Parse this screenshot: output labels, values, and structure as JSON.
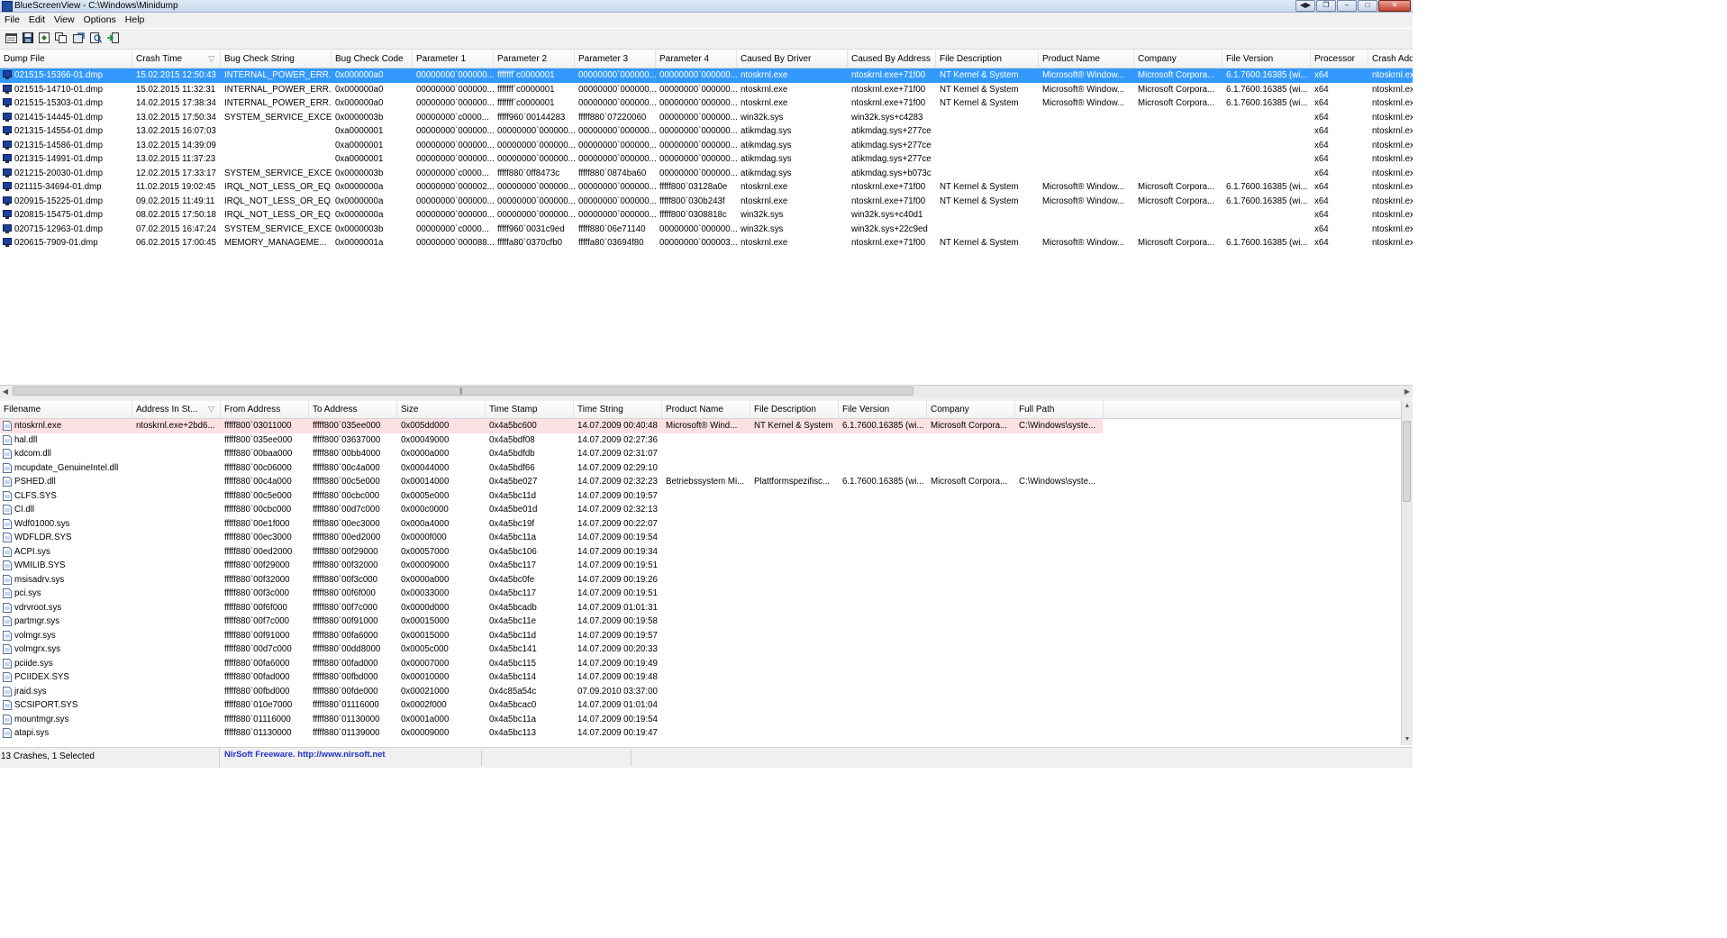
{
  "window": {
    "title": "BlueScreenView  -  C:\\Windows\\Minidump"
  },
  "menu": [
    "File",
    "Edit",
    "View",
    "Options",
    "Help"
  ],
  "toolbar_icons": [
    "properties-icon",
    "save-icon",
    "html-report-icon",
    "copy-icon",
    "refresh-icon",
    "find-icon",
    "exit-icon"
  ],
  "dumps": {
    "columns": [
      "Dump File",
      "Crash Time",
      "Bug Check String",
      "Bug Check Code",
      "Parameter 1",
      "Parameter 2",
      "Parameter 3",
      "Parameter 4",
      "Caused By Driver",
      "Caused By Address",
      "File Description",
      "Product Name",
      "Company",
      "File Version",
      "Processor",
      "Crash Address"
    ],
    "sorted_column": "Crash Time",
    "rows": [
      [
        "021515-15366-01.dmp",
        "15.02.2015 12:50:43",
        "INTERNAL_POWER_ERR...",
        "0x000000a0",
        "00000000`000000...",
        "fffffff`c0000001",
        "00000000`000000...",
        "00000000`000000...",
        "ntoskrnl.exe",
        "ntoskrnl.exe+71f00",
        "NT Kernel & System",
        "Microsoft® Window...",
        "Microsoft Corpora...",
        "6.1.7600.16385 (wi...",
        "x64",
        "ntoskrnl.exe"
      ],
      [
        "021515-14710-01.dmp",
        "15.02.2015 11:32:31",
        "INTERNAL_POWER_ERR...",
        "0x000000a0",
        "00000000`000000...",
        "fffffff`c0000001",
        "00000000`000000...",
        "00000000`000000...",
        "ntoskrnl.exe",
        "ntoskrnl.exe+71f00",
        "NT Kernel & System",
        "Microsoft® Window...",
        "Microsoft Corpora...",
        "6.1.7600.16385 (wi...",
        "x64",
        "ntoskrnl.exe"
      ],
      [
        "021515-15303-01.dmp",
        "14.02.2015 17:38:34",
        "INTERNAL_POWER_ERR...",
        "0x000000a0",
        "00000000`000000...",
        "fffffff`c0000001",
        "00000000`000000...",
        "00000000`000000...",
        "ntoskrnl.exe",
        "ntoskrnl.exe+71f00",
        "NT Kernel & System",
        "Microsoft® Window...",
        "Microsoft Corpora...",
        "6.1.7600.16385 (wi...",
        "x64",
        "ntoskrnl.exe"
      ],
      [
        "021415-14445-01.dmp",
        "13.02.2015 17:50:34",
        "SYSTEM_SERVICE_EXCE...",
        "0x0000003b",
        "00000000`c0000...",
        "fffff960`00144283",
        "fffff880`07220060",
        "00000000`000000...",
        "win32k.sys",
        "win32k.sys+c4283",
        "",
        "",
        "",
        "",
        "x64",
        "ntoskrnl.exe"
      ],
      [
        "021315-14554-01.dmp",
        "13.02.2015 16:07:03",
        "",
        "0xa0000001",
        "00000000`000000...",
        "00000000`000000...",
        "00000000`000000...",
        "00000000`000000...",
        "atikmdag.sys",
        "atikmdag.sys+277ce",
        "",
        "",
        "",
        "",
        "x64",
        "ntoskrnl.exe"
      ],
      [
        "021315-14586-01.dmp",
        "13.02.2015 14:39:09",
        "",
        "0xa0000001",
        "00000000`000000...",
        "00000000`000000...",
        "00000000`000000...",
        "00000000`000000...",
        "atikmdag.sys",
        "atikmdag.sys+277ce",
        "",
        "",
        "",
        "",
        "x64",
        "ntoskrnl.exe"
      ],
      [
        "021315-14991-01.dmp",
        "13.02.2015 11:37:23",
        "",
        "0xa0000001",
        "00000000`000000...",
        "00000000`000000...",
        "00000000`000000...",
        "00000000`000000...",
        "atikmdag.sys",
        "atikmdag.sys+277ce",
        "",
        "",
        "",
        "",
        "x64",
        "ntoskrnl.exe"
      ],
      [
        "021215-20030-01.dmp",
        "12.02.2015 17:33:17",
        "SYSTEM_SERVICE_EXCE...",
        "0x0000003b",
        "00000000`c0000...",
        "fffff880`0ff8473c",
        "fffff880`0874ba60",
        "00000000`000000...",
        "atikmdag.sys",
        "atikmdag.sys+b073c",
        "",
        "",
        "",
        "",
        "x64",
        "ntoskrnl.exe"
      ],
      [
        "021115-34694-01.dmp",
        "11.02.2015 19:02:45",
        "IRQL_NOT_LESS_OR_EQ...",
        "0x0000000a",
        "00000000`000002...",
        "00000000`000000...",
        "00000000`000000...",
        "fffff800`03128a0e",
        "ntoskrnl.exe",
        "ntoskrnl.exe+71f00",
        "NT Kernel & System",
        "Microsoft® Window...",
        "Microsoft Corpora...",
        "6.1.7600.16385 (wi...",
        "x64",
        "ntoskrnl.exe"
      ],
      [
        "020915-15225-01.dmp",
        "09.02.2015 11:49:11",
        "IRQL_NOT_LESS_OR_EQ...",
        "0x0000000a",
        "00000000`000000...",
        "00000000`000000...",
        "00000000`000000...",
        "fffff800`030b243f",
        "ntoskrnl.exe",
        "ntoskrnl.exe+71f00",
        "NT Kernel & System",
        "Microsoft® Window...",
        "Microsoft Corpora...",
        "6.1.7600.16385 (wi...",
        "x64",
        "ntoskrnl.exe"
      ],
      [
        "020815-15475-01.dmp",
        "08.02.2015 17:50:18",
        "IRQL_NOT_LESS_OR_EQ...",
        "0x0000000a",
        "00000000`000000...",
        "00000000`000000...",
        "00000000`000000...",
        "fffff800`0308818c",
        "win32k.sys",
        "win32k.sys+c40d1",
        "",
        "",
        "",
        "",
        "x64",
        "ntoskrnl.exe"
      ],
      [
        "020715-12963-01.dmp",
        "07.02.2015 16:47:24",
        "SYSTEM_SERVICE_EXCE...",
        "0x0000003b",
        "00000000`c0000...",
        "fffff960`0031c9ed",
        "fffff880`06e71140",
        "00000000`000000...",
        "win32k.sys",
        "win32k.sys+22c9ed",
        "",
        "",
        "",
        "",
        "x64",
        "ntoskrnl.exe"
      ],
      [
        "020615-7909-01.dmp",
        "06.02.2015 17:00:45",
        "MEMORY_MANAGEME...",
        "0x0000001a",
        "00000000`000088...",
        "fffffa80`0370cfb0",
        "fffffa80`03694f80",
        "00000000`000003...",
        "ntoskrnl.exe",
        "ntoskrnl.exe+71f00",
        "NT Kernel & System",
        "Microsoft® Window...",
        "Microsoft Corpora...",
        "6.1.7600.16385 (wi...",
        "x64",
        "ntoskrnl.exe"
      ]
    ]
  },
  "drivers": {
    "columns": [
      "Filename",
      "Address In St...",
      "From Address",
      "To Address",
      "Size",
      "Time Stamp",
      "Time String",
      "Product Name",
      "File Description",
      "File Version",
      "Company",
      "Full Path"
    ],
    "rows": [
      [
        "ntoskrnl.exe",
        "ntoskrnl.exe+2bd6...",
        "fffff800`03011000",
        "fffff800`035ee000",
        "0x005dd000",
        "0x4a5bc600",
        "14.07.2009 00:40:48",
        "Microsoft® Wind...",
        "NT Kernel & System",
        "6.1.7600.16385 (wi...",
        "Microsoft Corpora...",
        "C:\\Windows\\syste..."
      ],
      [
        "hal.dll",
        "",
        "fffff800`035ee000",
        "fffff800`03637000",
        "0x00049000",
        "0x4a5bdf08",
        "14.07.2009 02:27:36",
        "",
        "",
        "",
        "",
        ""
      ],
      [
        "kdcom.dll",
        "",
        "fffff880`00baa000",
        "fffff880`00bb4000",
        "0x0000a000",
        "0x4a5bdfdb",
        "14.07.2009 02:31:07",
        "",
        "",
        "",
        "",
        ""
      ],
      [
        "mcupdate_GenuineIntel.dll",
        "",
        "fffff880`00c06000",
        "fffff880`00c4a000",
        "0x00044000",
        "0x4a5bdf66",
        "14.07.2009 02:29:10",
        "",
        "",
        "",
        "",
        ""
      ],
      [
        "PSHED.dll",
        "",
        "fffff880`00c4a000",
        "fffff880`00c5e000",
        "0x00014000",
        "0x4a5be027",
        "14.07.2009 02:32:23",
        "Betriebssystem Mi...",
        "Plattformspezifisc...",
        "6.1.7600.16385 (wi...",
        "Microsoft Corpora...",
        "C:\\Windows\\syste..."
      ],
      [
        "CLFS.SYS",
        "",
        "fffff880`00c5e000",
        "fffff880`00cbc000",
        "0x0005e000",
        "0x4a5bc11d",
        "14.07.2009 00:19:57",
        "",
        "",
        "",
        "",
        ""
      ],
      [
        "CI.dll",
        "",
        "fffff880`00cbc000",
        "fffff880`00d7c000",
        "0x000c0000",
        "0x4a5be01d",
        "14.07.2009 02:32:13",
        "",
        "",
        "",
        "",
        ""
      ],
      [
        "Wdf01000.sys",
        "",
        "fffff880`00e1f000",
        "fffff880`00ec3000",
        "0x000a4000",
        "0x4a5bc19f",
        "14.07.2009 00:22:07",
        "",
        "",
        "",
        "",
        ""
      ],
      [
        "WDFLDR.SYS",
        "",
        "fffff880`00ec3000",
        "fffff880`00ed2000",
        "0x0000f000",
        "0x4a5bc11a",
        "14.07.2009 00:19:54",
        "",
        "",
        "",
        "",
        ""
      ],
      [
        "ACPI.sys",
        "",
        "fffff880`00ed2000",
        "fffff880`00f29000",
        "0x00057000",
        "0x4a5bc106",
        "14.07.2009 00:19:34",
        "",
        "",
        "",
        "",
        ""
      ],
      [
        "WMILIB.SYS",
        "",
        "fffff880`00f29000",
        "fffff880`00f32000",
        "0x00009000",
        "0x4a5bc117",
        "14.07.2009 00:19:51",
        "",
        "",
        "",
        "",
        ""
      ],
      [
        "msisadrv.sys",
        "",
        "fffff880`00f32000",
        "fffff880`00f3c000",
        "0x0000a000",
        "0x4a5bc0fe",
        "14.07.2009 00:19:26",
        "",
        "",
        "",
        "",
        ""
      ],
      [
        "pci.sys",
        "",
        "fffff880`00f3c000",
        "fffff880`00f6f000",
        "0x00033000",
        "0x4a5bc117",
        "14.07.2009 00:19:51",
        "",
        "",
        "",
        "",
        ""
      ],
      [
        "vdrvroot.sys",
        "",
        "fffff880`00f6f000",
        "fffff880`00f7c000",
        "0x0000d000",
        "0x4a5bcadb",
        "14.07.2009 01:01:31",
        "",
        "",
        "",
        "",
        ""
      ],
      [
        "partmgr.sys",
        "",
        "fffff880`00f7c000",
        "fffff880`00f91000",
        "0x00015000",
        "0x4a5bc11e",
        "14.07.2009 00:19:58",
        "",
        "",
        "",
        "",
        ""
      ],
      [
        "volmgr.sys",
        "",
        "fffff880`00f91000",
        "fffff880`00fa6000",
        "0x00015000",
        "0x4a5bc11d",
        "14.07.2009 00:19:57",
        "",
        "",
        "",
        "",
        ""
      ],
      [
        "volmgrx.sys",
        "",
        "fffff880`00d7c000",
        "fffff880`00dd8000",
        "0x0005c000",
        "0x4a5bc141",
        "14.07.2009 00:20:33",
        "",
        "",
        "",
        "",
        ""
      ],
      [
        "pciide.sys",
        "",
        "fffff880`00fa6000",
        "fffff880`00fad000",
        "0x00007000",
        "0x4a5bc115",
        "14.07.2009 00:19:49",
        "",
        "",
        "",
        "",
        ""
      ],
      [
        "PCIIDEX.SYS",
        "",
        "fffff880`00fad000",
        "fffff880`00fbd000",
        "0x00010000",
        "0x4a5bc114",
        "14.07.2009 00:19:48",
        "",
        "",
        "",
        "",
        ""
      ],
      [
        "jraid.sys",
        "",
        "fffff880`00fbd000",
        "fffff880`00fde000",
        "0x00021000",
        "0x4c85a54c",
        "07.09.2010 03:37:00",
        "",
        "",
        "",
        "",
        ""
      ],
      [
        "SCSIPORT.SYS",
        "",
        "fffff880`010e7000",
        "fffff880`01116000",
        "0x0002f000",
        "0x4a5bcac0",
        "14.07.2009 01:01:04",
        "",
        "",
        "",
        "",
        ""
      ],
      [
        "mountmgr.sys",
        "",
        "fffff880`01116000",
        "fffff880`01130000",
        "0x0001a000",
        "0x4a5bc11a",
        "14.07.2009 00:19:54",
        "",
        "",
        "",
        "",
        ""
      ],
      [
        "atapi.sys",
        "",
        "fffff880`01130000",
        "fffff880`01139000",
        "0x00009000",
        "0x4a5bc113",
        "14.07.2009 00:19:47",
        "",
        "",
        "",
        "",
        ""
      ]
    ]
  },
  "status": {
    "left": "13 Crashes, 1 Selected",
    "right": "NirSoft Freeware.  http://www.nirsoft.net"
  },
  "colors": {
    "selected": "#3399ff",
    "highlight": "#fbe0e4",
    "link": "#1f33c8"
  }
}
